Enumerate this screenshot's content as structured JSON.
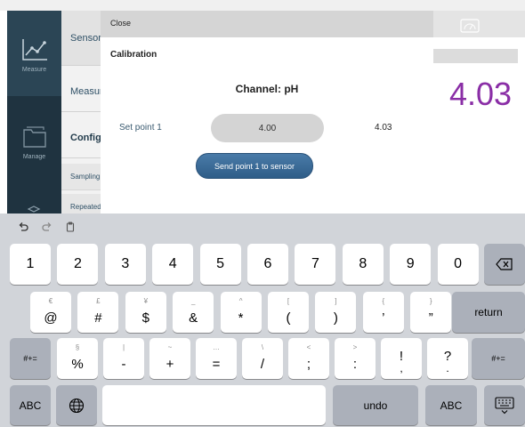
{
  "app": {
    "rail": {
      "measure_label": "Measure",
      "manage_label": "Manage"
    },
    "menu": {
      "sensor": "Sensor",
      "measure": "Measure",
      "configure": "Configure",
      "sampling": "Sampling",
      "repeated": "Repeated"
    },
    "reading": "4.03"
  },
  "modal": {
    "close_label": "Close",
    "heading": "Calibration",
    "channel_title": "Channel: pH",
    "setpoint_label": "Set point 1",
    "setpoint_value": "4.00",
    "setpoint_reading": "4.03",
    "send_button_label": "Send point 1 to sensor"
  },
  "keyboard": {
    "row1": [
      "1",
      "2",
      "3",
      "4",
      "5",
      "6",
      "7",
      "8",
      "9",
      "0"
    ],
    "row2": [
      {
        "main": "@",
        "alt": "€"
      },
      {
        "main": "#",
        "alt": "£"
      },
      {
        "main": "$",
        "alt": "¥"
      },
      {
        "main": "&",
        "alt": "_"
      },
      {
        "main": "*",
        "alt": "^"
      },
      {
        "main": "(",
        "alt": "["
      },
      {
        "main": ")",
        "alt": "]"
      },
      {
        "main": "’",
        "alt": "{"
      },
      {
        "main": "”",
        "alt": "}"
      }
    ],
    "return_label": "return",
    "row3": [
      {
        "main": "%",
        "alt": "§"
      },
      {
        "main": "-",
        "alt": "|"
      },
      {
        "main": "+",
        "alt": "~"
      },
      {
        "main": "=",
        "alt": "…"
      },
      {
        "main": "/",
        "alt": "\\"
      },
      {
        "main": ";",
        "alt": "<"
      },
      {
        "main": ":",
        "alt": ">"
      },
      {
        "main": "!",
        "alt": ""
      },
      {
        "main": "?",
        "alt": ""
      }
    ],
    "row3_extra": {
      "exclam_sub": ",",
      "question_sub": "."
    },
    "shift_label": "#+=",
    "abc_label": "ABC",
    "undo_label": "undo"
  },
  "icons": {
    "undo": "undo-icon",
    "redo": "redo-icon",
    "paste": "paste-icon",
    "backspace": "backspace-icon",
    "globe": "globe-icon",
    "dismiss": "keyboard-dismiss-icon",
    "chart": "line-chart-icon",
    "folder": "folder-icon",
    "gauge": "gauge-icon"
  },
  "colors": {
    "rail_bg": "#1f3340",
    "reading": "#8a2ea6",
    "send_button": "#3a6a96",
    "keyboard_bg": "#d1d4d9"
  }
}
